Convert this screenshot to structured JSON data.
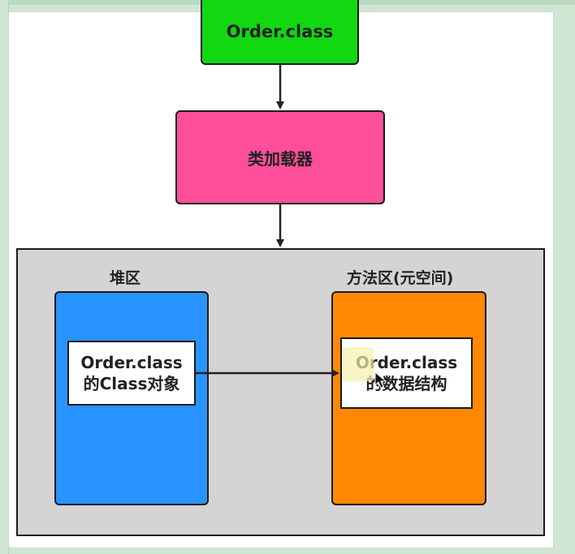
{
  "diagram": {
    "nodes": {
      "order_class": "Order.class",
      "class_loader": "类加载器",
      "heap_area": "堆区",
      "method_area": "方法区(元空间)",
      "class_object_line1": "Order.class",
      "class_object_line2": "的Class对象",
      "data_structure_line1": "Order.class",
      "data_structure_line2": "的数据结构"
    },
    "colors": {
      "order_class": "#12d812",
      "class_loader": "#ff4f9a",
      "heap_area": "#2894ff",
      "method_area": "#ff8800",
      "runtime_area": "#d4d4d4"
    },
    "edges": [
      {
        "from": "order_class",
        "to": "class_loader"
      },
      {
        "from": "class_loader",
        "to": "runtime_area"
      },
      {
        "from": "class_object",
        "to": "data_structure"
      }
    ],
    "icons": {
      "pointer": "mouse-cursor-icon"
    }
  }
}
